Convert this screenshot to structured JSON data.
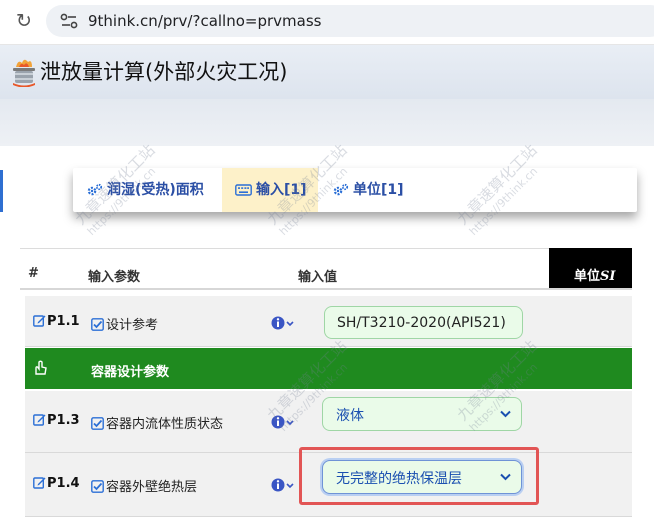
{
  "browser": {
    "url": "9think.cn/prv/?callno=prvmass"
  },
  "page": {
    "title": "泄放量计算(外部火灾工况)"
  },
  "tabs": [
    {
      "label": "润湿(受热)面积",
      "icon": "cogs-icon",
      "active": false
    },
    {
      "label": "输入[1]",
      "icon": "keyboard-icon",
      "active": true
    },
    {
      "label": "单位[1]",
      "icon": "cogs-icon",
      "active": false
    }
  ],
  "table": {
    "headers": {
      "hash": "#",
      "param": "输入参数",
      "value": "输入值",
      "unit_prefix": "单位",
      "unit_si": "SI"
    },
    "rows": [
      {
        "id": "P1.1",
        "name": "设计参考",
        "value": "SH/T3210-2020(API521)",
        "kind": "text"
      },
      {
        "section": "容器设计参数"
      },
      {
        "id": "P1.3",
        "name": "容器内流体性质状态",
        "value": "液体",
        "kind": "select"
      },
      {
        "id": "P1.4",
        "name": "容器外壁绝热层",
        "value": "无完整的绝热保温层",
        "kind": "select"
      }
    ]
  },
  "watermark": {
    "text": "九章速算化工站",
    "url": "https://9think.cn"
  },
  "colors": {
    "tab_text": "#2b4fa5",
    "active_tab_bg": "#fdf1c9",
    "section_bg": "#1f8a1f",
    "field_bg": "#eafbe9",
    "highlight": "#e25555",
    "unit_header_bg": "#000000"
  }
}
